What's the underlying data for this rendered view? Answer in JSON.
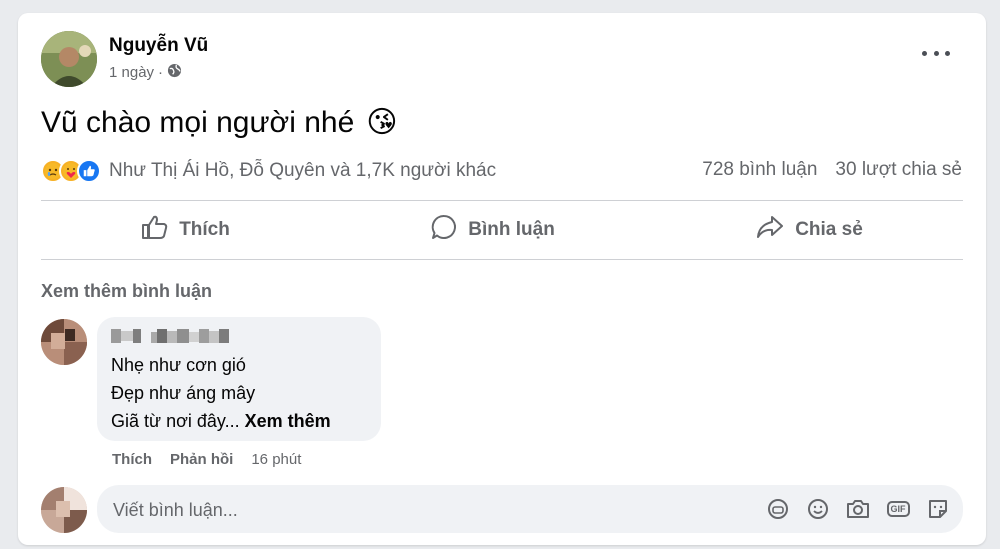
{
  "post": {
    "author": "Nguyễn Vũ",
    "time": "1 ngày",
    "separator": "·",
    "text": "Vũ chào mọi người nhé",
    "emoji": "😘"
  },
  "reactions": {
    "icons": [
      "sad",
      "care",
      "like"
    ],
    "summary": "Như Thị Ái Hồ, Đỗ Quyên và 1,7K người khác",
    "comments_count": "728 bình luận",
    "shares_count": "30 lượt chia sẻ"
  },
  "actions": {
    "like": "Thích",
    "comment": "Bình luận",
    "share": "Chia sẻ"
  },
  "comments": {
    "view_more": "Xem thêm bình luận",
    "items": [
      {
        "lines": [
          "Nhẹ như cơn gió",
          "Đẹp như áng mây",
          "Giã từ nơi đây..."
        ],
        "see_more": "Xem thêm",
        "like": "Thích",
        "reply": "Phản hồi",
        "time": "16 phút"
      }
    ]
  },
  "composer": {
    "placeholder": "Viết bình luận..."
  },
  "colors": {
    "secondary_text": "#65676b",
    "bubble": "#f0f2f5",
    "like_blue": "#1877f2"
  }
}
